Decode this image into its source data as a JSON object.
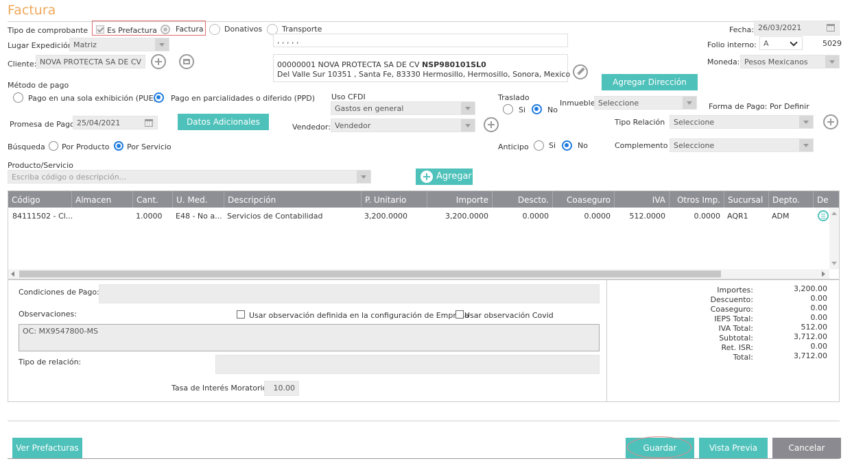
{
  "header": {
    "title": "Factura"
  },
  "tipo": {
    "label": "Tipo de comprobante",
    "options": [
      "Es Prefactura",
      "Factura",
      "Donativos",
      "Transporte"
    ]
  },
  "fecha": {
    "label": "Fecha:",
    "value": "26/03/2021"
  },
  "lugar": {
    "label": "Lugar Expedición",
    "value": "Matriz"
  },
  "address_line": {
    "value": ", , , , ,"
  },
  "folio": {
    "label": "Folio interno:",
    "serie": "A",
    "number": "5029"
  },
  "cliente": {
    "label": "Cliente:",
    "value": "NOVA PROTECTA SA DE CV"
  },
  "cliente_box": {
    "line1_prefix": "00000001 NOVA PROTECTA SA DE CV ",
    "rfc": "NSP980101SL0",
    "line2": "Del Valle Sur 10351 , Santa Fe, 83330 Hermosillo, Hermosillo, Sonora, Mexico"
  },
  "moneda": {
    "label": "Moneda:",
    "value": "Pesos Mexicanos"
  },
  "agregar_direccion": "Agregar Dirección",
  "metodo": {
    "label": "Método de pago",
    "pue": "Pago en una sola exhibición (PUE)",
    "ppd": "Pago en parcialidades o diferido (PPD)"
  },
  "uso_cfdi": {
    "label": "Uso CFDI",
    "value": "Gastos en general"
  },
  "traslado": {
    "label": "Traslado",
    "si": "Si",
    "no": "No"
  },
  "inmueble": {
    "label": "Inmueble",
    "value": "Seleccione"
  },
  "forma_pago": {
    "label": "Forma de Pago: Por Definir"
  },
  "promesa": {
    "label": "Promesa de Pago",
    "value": "25/04/2021"
  },
  "datos_adicionales": "Datos Adicionales",
  "vendedor": {
    "label": "Vendedor:",
    "value": "Vendedor"
  },
  "tipo_relacion_top": {
    "label": "Tipo Relación",
    "value": "Seleccione"
  },
  "busqueda": {
    "label": "Búsqueda",
    "producto": "Por Producto",
    "servicio": "Por Servicio"
  },
  "anticipo": {
    "label": "Anticipo",
    "si": "Si",
    "no": "No"
  },
  "complemento": {
    "label": "Complemento",
    "value": "Seleccione"
  },
  "producto": {
    "label": "Producto/Servicio",
    "placeholder": "Escriba código o descripción..."
  },
  "agregar": "Agregar",
  "table": {
    "columns": [
      "Código",
      "Almacen",
      "Cant.",
      "U. Med.",
      "Descripción",
      "P. Unitario",
      "Importe",
      "Descto.",
      "Coaseguro",
      "IVA",
      "Otros Imp.",
      "Sucursal",
      "Depto.",
      "De"
    ],
    "rows": [
      [
        "84111502 - Cl...",
        "",
        "1.0000",
        "E48 - No a...",
        "Servicios de Contabilidad",
        "3,200.0000",
        "3,200.0000",
        "0.0000",
        "0.0000",
        "512.0000",
        "0.0000",
        "AQR1",
        "ADM"
      ]
    ]
  },
  "condiciones": {
    "label": "Condiciones de Pago:"
  },
  "observaciones": {
    "label": "Observaciones:",
    "chk1": "Usar observación definida en la configuración de Empresa",
    "chk2": "Usar observación Covid",
    "value": "OC: MX9547800-MS"
  },
  "tipo_relacion": {
    "label": "Tipo de relación:"
  },
  "tasa": {
    "label": "Tasa de Interés Moratorio",
    "value": "10.00"
  },
  "totals": [
    {
      "label": "Importes:",
      "value": "3,200.00"
    },
    {
      "label": "Descuento:",
      "value": "0.00"
    },
    {
      "label": "Coaseguro:",
      "value": "0.00"
    },
    {
      "label": "IEPS Total:",
      "value": "0.00"
    },
    {
      "label": "IVA Total:",
      "value": "512.00"
    },
    {
      "label": "Subtotal:",
      "value": "3,712.00"
    },
    {
      "label": "Ret. ISR:",
      "value": "0.00"
    },
    {
      "label": "Total:",
      "value": "3,712.00"
    }
  ],
  "footer": {
    "ver_prefacturas": "Ver Prefacturas",
    "guardar": "Guardar",
    "vista_previa": "Vista Previa",
    "cancelar": "Cancelar"
  },
  "colors": {
    "accent_orange": "#f0a85a",
    "teal": "#4ec1ba",
    "radio_blue": "#1e7be0",
    "grid_header": "#8e8e95",
    "cancel_gray": "#8a8a90",
    "highlight_red": "#e04848"
  }
}
